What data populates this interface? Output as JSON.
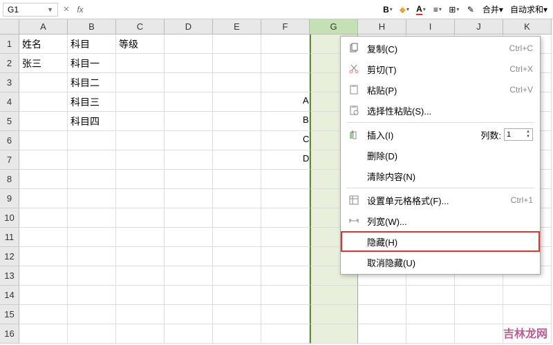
{
  "namebox": {
    "value": "G1"
  },
  "toolbar": {
    "merge_label": "合并",
    "autosum_label": "自动求和"
  },
  "columns": [
    "A",
    "B",
    "C",
    "D",
    "E",
    "F",
    "G",
    "H",
    "I",
    "J",
    "K"
  ],
  "rows": [
    "1",
    "2",
    "3",
    "4",
    "5",
    "6",
    "7",
    "8",
    "9",
    "10",
    "11",
    "12",
    "13",
    "14",
    "15",
    "16"
  ],
  "cells": {
    "A1": "姓名",
    "B1": "科目",
    "C1": "等级",
    "A2": "张三",
    "B2": "科目一",
    "B3": "科目二",
    "B4": "科目三",
    "B5": "科目四"
  },
  "col_g_overlay": [
    "A",
    "B",
    "C",
    "D"
  ],
  "context_menu": {
    "copy": {
      "label": "复制(C)",
      "shortcut": "Ctrl+C"
    },
    "cut": {
      "label": "剪切(T)",
      "shortcut": "Ctrl+X"
    },
    "paste": {
      "label": "粘贴(P)",
      "shortcut": "Ctrl+V"
    },
    "paste_special": {
      "label": "选择性粘贴(S)..."
    },
    "insert": {
      "label": "插入(I)",
      "col_count_label": "列数:",
      "col_count_value": "1"
    },
    "delete": {
      "label": "删除(D)"
    },
    "clear": {
      "label": "清除内容(N)"
    },
    "format_cells": {
      "label": "设置单元格格式(F)...",
      "shortcut": "Ctrl+1"
    },
    "col_width": {
      "label": "列宽(W)..."
    },
    "hide": {
      "label": "隐藏(H)"
    },
    "unhide": {
      "label": "取消隐藏(U)"
    }
  },
  "watermark": "吉林龙网"
}
